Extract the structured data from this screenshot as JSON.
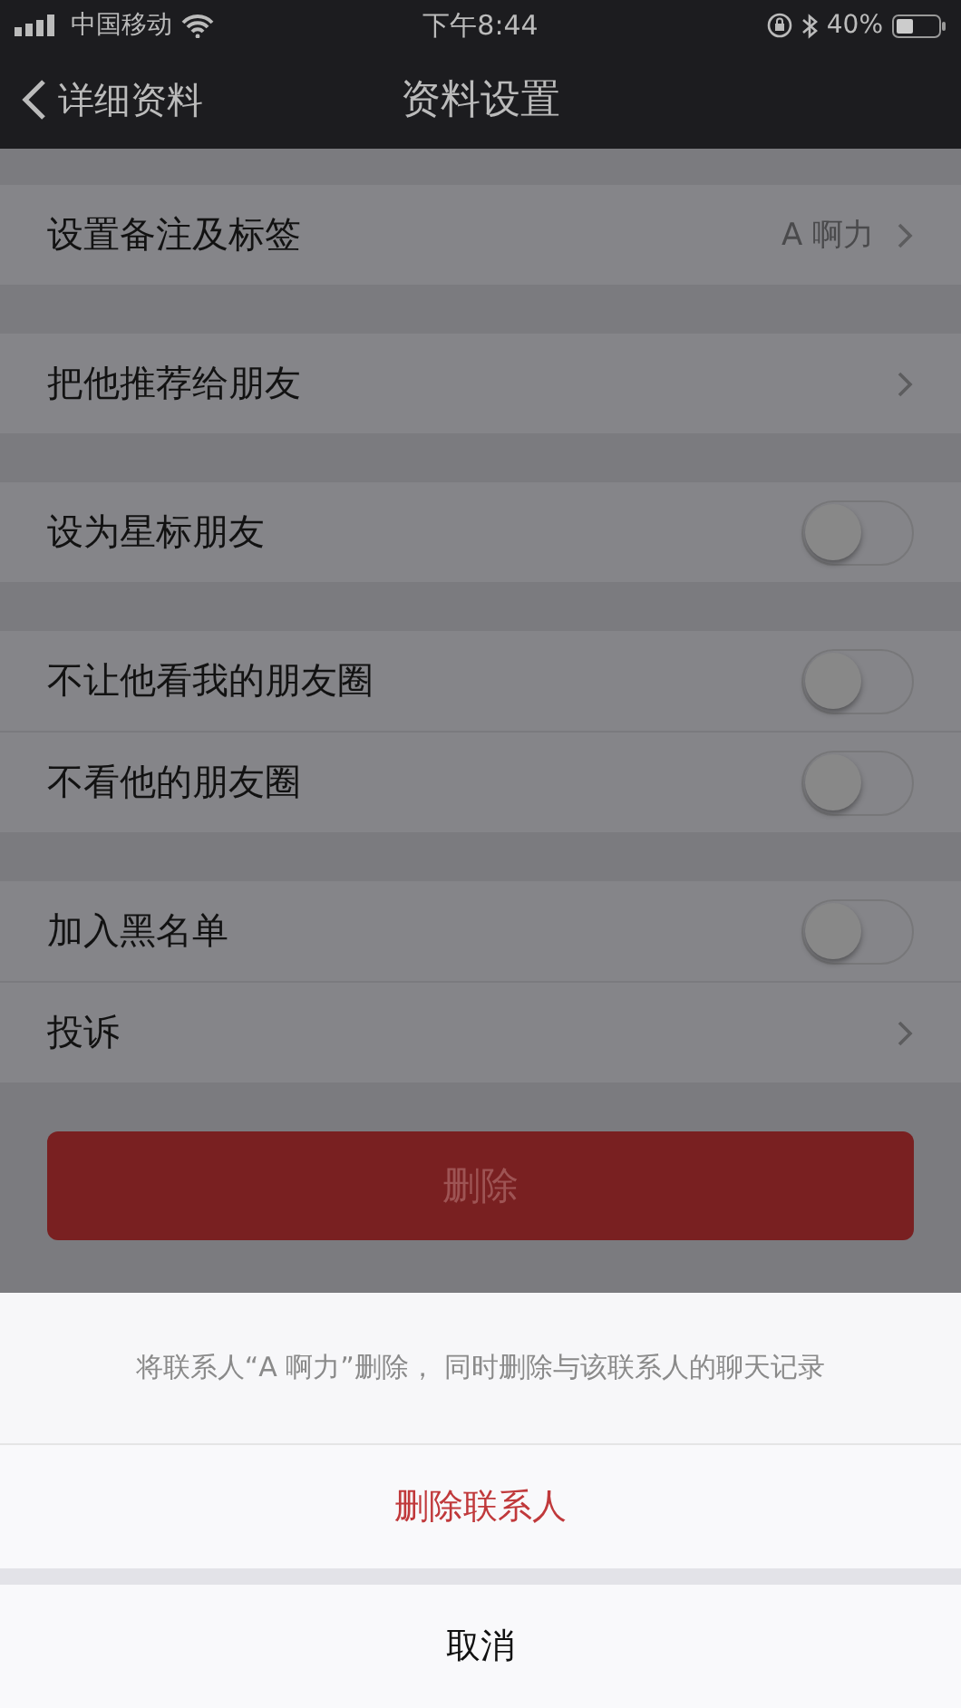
{
  "status_bar": {
    "carrier": "中国移动",
    "time": "下午8:44",
    "battery": "40%"
  },
  "nav": {
    "back": "详细资料",
    "title": "资料设置"
  },
  "groups": [
    {
      "rows": [
        {
          "kind": "value",
          "label": "设置备注及标签",
          "value": "A  啊力"
        }
      ]
    },
    {
      "rows": [
        {
          "kind": "link",
          "label": "把他推荐给朋友"
        }
      ]
    },
    {
      "rows": [
        {
          "kind": "switch",
          "label": "设为星标朋友",
          "on": false
        }
      ]
    },
    {
      "rows": [
        {
          "kind": "switch",
          "label": "不让他看我的朋友圈",
          "on": false
        },
        {
          "kind": "switch",
          "label": "不看他的朋友圈",
          "on": false
        }
      ]
    },
    {
      "rows": [
        {
          "kind": "switch",
          "label": "加入黑名单",
          "on": false
        },
        {
          "kind": "link",
          "label": "投诉"
        }
      ]
    }
  ],
  "delete_button": "删除",
  "action_sheet": {
    "message": "将联系人“A  啊力”删除， 同时删除与该联系人的聊天记录",
    "destructive": "删除联系人",
    "cancel": "取消"
  }
}
